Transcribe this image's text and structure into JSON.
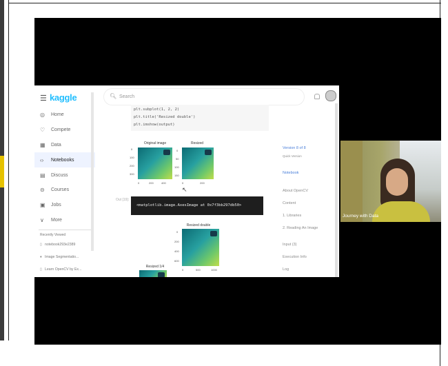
{
  "kaggle": {
    "logo": "kaggle",
    "search_placeholder": "Search",
    "nav": [
      {
        "icon": "compass-icon",
        "glyph": "◎",
        "label": "Home"
      },
      {
        "icon": "trophy-icon",
        "glyph": "♡",
        "label": "Compete"
      },
      {
        "icon": "table-icon",
        "glyph": "▦",
        "label": "Data"
      },
      {
        "icon": "code-icon",
        "glyph": "‹›",
        "label": "Notebooks"
      },
      {
        "icon": "comment-icon",
        "glyph": "▤",
        "label": "Discuss"
      },
      {
        "icon": "courses-icon",
        "glyph": "⊝",
        "label": "Courses"
      },
      {
        "icon": "jobs-icon",
        "glyph": "▣",
        "label": "Jobs"
      },
      {
        "icon": "chevron-down-icon",
        "glyph": "∨",
        "label": "More"
      }
    ],
    "recently_viewed_title": "Recently Viewed",
    "recently_viewed": [
      "notebook293e2389",
      "Image Segmentatio...",
      "Learn OpenCV by Ex..."
    ],
    "code_lines": [
      "plt.subplot(1, 2, 2)",
      "plt.title('Resized double')",
      "plt.imshow(output)"
    ],
    "images": {
      "original_caption": "Original image",
      "resized_caption": "Resized",
      "resized_double_caption": "Resized double",
      "resized_half_caption": "Resized 1/4",
      "y_ticks": [
        "0",
        "100",
        "200",
        "300"
      ],
      "x_ticks": [
        "0",
        "200",
        "400"
      ],
      "x_ticks_small": [
        "0",
        "200"
      ],
      "y_ticks_small": [
        "0",
        "50",
        "100",
        "150"
      ],
      "y_ticks_large": [
        "0",
        "200",
        "400",
        "600"
      ],
      "x_ticks_large": [
        "0",
        "500",
        "1000"
      ]
    },
    "cell_number": "Out [19]:",
    "output_text": "<matplotlib.image.AxesImage at 0x7f3bb297db50>",
    "right_panel": {
      "version": "Version 8 of 8",
      "quick_version": "Quick Version",
      "notebook": "Notebook",
      "items": [
        "About OpenCV",
        "Content",
        "1. Libraries",
        "2. Reading An Image",
        "Input (3)",
        "Execution Info",
        "Log"
      ]
    }
  },
  "video": {
    "caption": "Journey with Data"
  }
}
